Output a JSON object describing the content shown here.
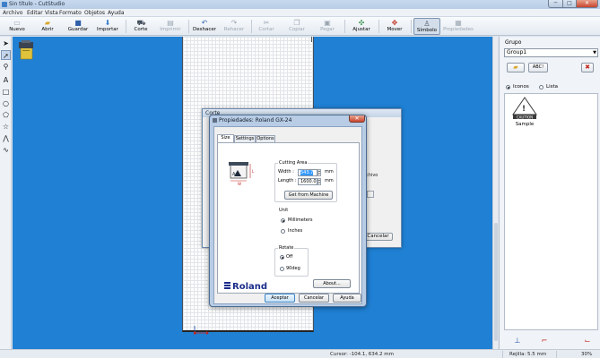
{
  "window": {
    "title": "Sin título - CutStudio",
    "minimize": "─",
    "maximize": "□",
    "close": "✕"
  },
  "menu": [
    "Archivo",
    "Editar",
    "Vista",
    "Formato",
    "Objetos",
    "Ayuda"
  ],
  "toolbar": {
    "nuevo": "Nuevo",
    "abrir": "Abrir",
    "guardar": "Guardar",
    "importar": "Importar",
    "corte": "Corte",
    "imprimir": "Imprimir",
    "deshacer": "Deshacer",
    "rehacer": "Rehacer",
    "cortar": "Cortar",
    "copiar": "Copiar",
    "pegar": "Pegar",
    "ajustar": "Ajustar",
    "mover": "Mover",
    "simbolo": "Símbolo",
    "propiedades": "Propiedades"
  },
  "corte_dialog": {
    "title": "Corte",
    "archivo_fragment": "archivo",
    "cancel": "Cancelar"
  },
  "properties_dialog": {
    "title": "Propiedades: Roland GX-24",
    "close": "✕",
    "tabs": [
      "Size",
      "Settings",
      "Options"
    ],
    "cutting_area": {
      "title": "Cutting Area",
      "width_label": "Width :",
      "width_value": "543.7",
      "length_label": "Length :",
      "length_value": "1600.0",
      "unit": "mm",
      "get_from_machine": "Get from Machine"
    },
    "unit_group": {
      "title": "Unit",
      "options": [
        "Millimeters",
        "Inches"
      ],
      "selected": "Millimeters"
    },
    "rotate_group": {
      "title": "Rotate",
      "options": [
        "Off",
        "90deg"
      ],
      "selected": "Off"
    },
    "about": "About...",
    "brand": "Roland",
    "ok": "Aceptar",
    "cancel": "Cancelar",
    "help": "Ayuda"
  },
  "right_panel": {
    "group_label": "Grupo",
    "group_value": "Group1",
    "abc_button": "ABC!",
    "view_options": [
      "Iconos",
      "Lista"
    ],
    "view_selected": "Iconos",
    "symbol_name": "Sample",
    "symbol_text": "CAUTION"
  },
  "status": {
    "cursor": "Cursor: -104.1, 634.2 mm",
    "grid": "Rejilla: 5.5 mm",
    "zoom": "30%"
  }
}
